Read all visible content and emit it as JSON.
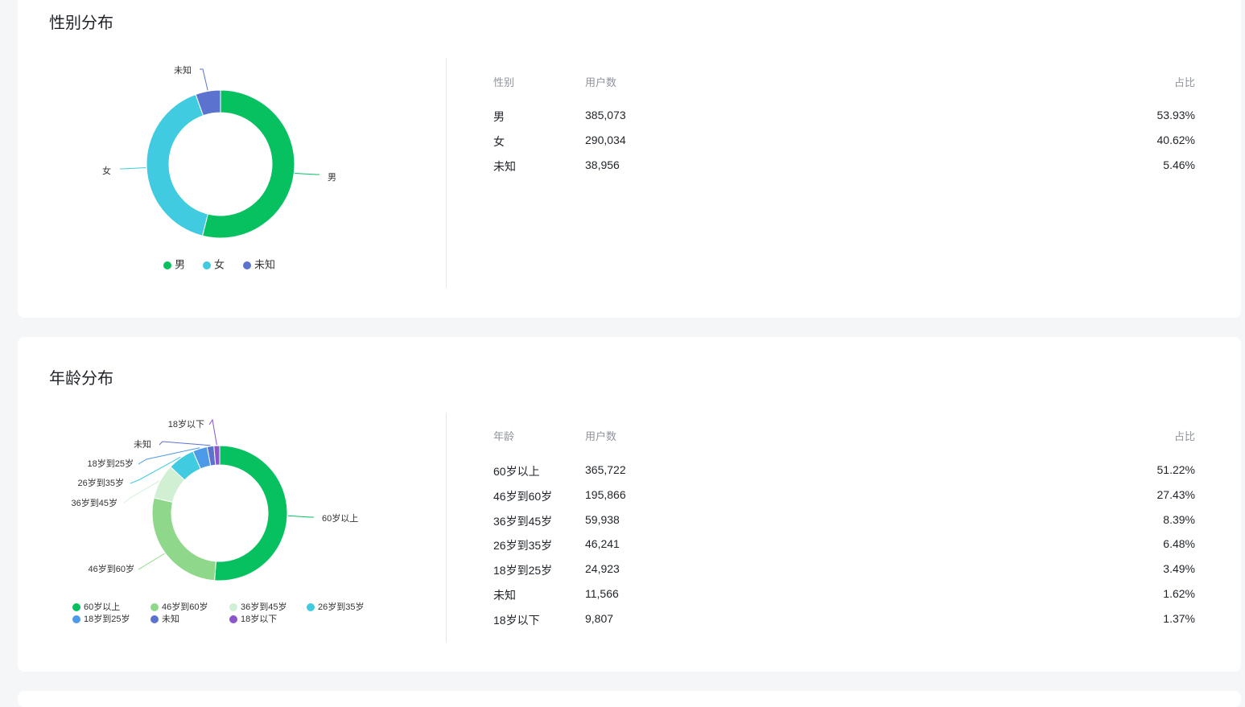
{
  "gender": {
    "title": "性别分布",
    "table": {
      "headers": [
        "性别",
        "用户数",
        "占比"
      ],
      "rows": [
        [
          "男",
          "385,073",
          "53.93%"
        ],
        [
          "女",
          "290,034",
          "40.62%"
        ],
        [
          "未知",
          "38,956",
          "5.46%"
        ]
      ]
    },
    "chart_data": {
      "type": "pie",
      "categories": [
        "男",
        "女",
        "未知"
      ],
      "values": [
        385073,
        290034,
        38956
      ],
      "colors": [
        "#07c160",
        "#40cbe0",
        "#5b73cf"
      ]
    }
  },
  "age": {
    "title": "年龄分布",
    "table": {
      "headers": [
        "年龄",
        "用户数",
        "占比"
      ],
      "rows": [
        [
          "60岁以上",
          "365,722",
          "51.22%"
        ],
        [
          "46岁到60岁",
          "195,866",
          "27.43%"
        ],
        [
          "36岁到45岁",
          "59,938",
          "8.39%"
        ],
        [
          "26岁到35岁",
          "46,241",
          "6.48%"
        ],
        [
          "18岁到25岁",
          "24,923",
          "3.49%"
        ],
        [
          "未知",
          "11,566",
          "1.62%"
        ],
        [
          "18岁以下",
          "9,807",
          "1.37%"
        ]
      ]
    },
    "chart_data": {
      "type": "pie",
      "categories": [
        "60岁以上",
        "46岁到60岁",
        "36岁到45岁",
        "26岁到35岁",
        "18岁到25岁",
        "未知",
        "18岁以下"
      ],
      "values": [
        365722,
        195866,
        59938,
        46241,
        24923,
        11566,
        9807
      ],
      "colors": [
        "#07c160",
        "#8fd88b",
        "#d1efd3",
        "#40cbe0",
        "#4d9be8",
        "#5b73cf",
        "#8b55cc"
      ]
    }
  }
}
